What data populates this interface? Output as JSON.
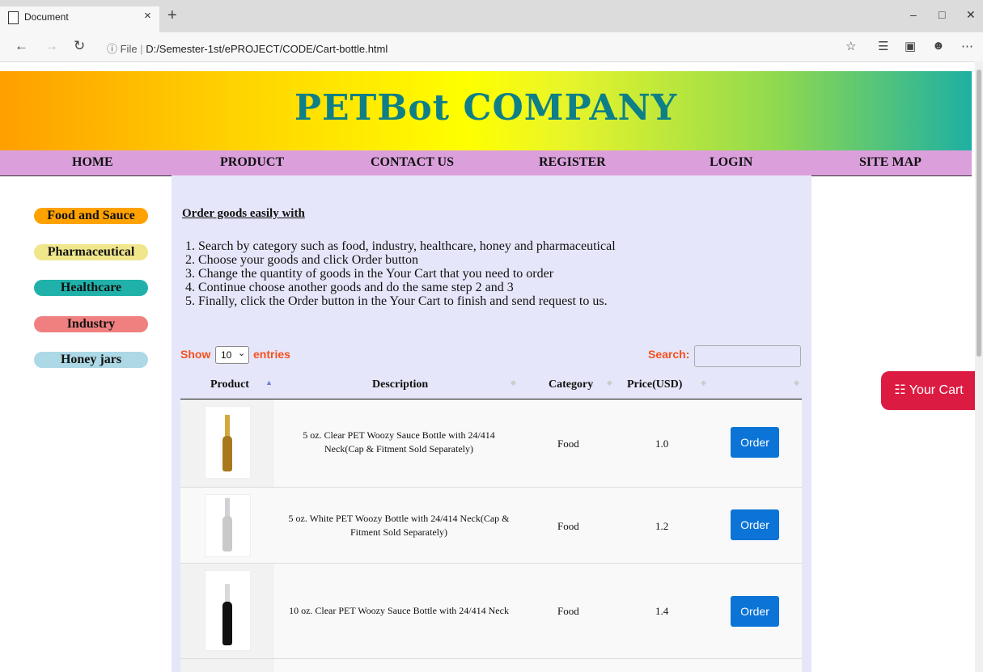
{
  "browser": {
    "tab_title": "Document",
    "tab_close": "×",
    "new_tab": "+",
    "address_prefix": "ⓘ File",
    "address_url": "D:/Semester-1st/ePROJECT/CODE/Cart-bottle.html"
  },
  "banner": {
    "title": "PETBot COMPANY"
  },
  "menu": [
    "HOME",
    "PRODUCT",
    "CONTACT US",
    "REGISTER",
    "LOGIN",
    "SITE MAP"
  ],
  "categories": [
    {
      "label": "Food and Sauce",
      "color": "#ffa200"
    },
    {
      "label": "Pharmaceutical",
      "color": "#f0e68c"
    },
    {
      "label": "Healthcare",
      "color": "#20b2aa"
    },
    {
      "label": "Industry",
      "color": "#f08080"
    },
    {
      "label": "Honey jars",
      "color": "#add8e6"
    }
  ],
  "intro": "Order goods easily with",
  "steps": [
    "1. Search by category such as food, industry, healthcare, honey and pharmaceutical",
    "2. Choose your goods and click Order button",
    "3. Change the quantity of goods in the Your Cart that you need to order",
    "4. Continue choose another goods and do the same step 2 and 3",
    "5. Finally, click the Order button in the Your Cart to finish and send request to us."
  ],
  "table": {
    "show_label": "Show",
    "entries_value": "10",
    "entries_label": "entries",
    "search_label": "Search:",
    "columns": [
      "Product",
      "Description",
      "Category",
      "Price(USD)"
    ],
    "order_label": "Order",
    "rows": [
      {
        "desc_line1": "5 oz. Clear PET Woozy Sauce Bottle with 24/414",
        "desc_line2": "Neck(Cap & Fitment Sold Separately)",
        "category": "Food",
        "price": "1.0",
        "bottle_color": "#a8791c"
      },
      {
        "desc_line1": "5 oz. White PET Woozy Bottle with 24/414 Neck(Cap &",
        "desc_line2": "Fitment Sold Separately)",
        "category": "Food",
        "price": "1.2",
        "bottle_color": "#c9c9cc"
      },
      {
        "desc_line1": "10 oz. Clear PET Woozy Sauce Bottle with 24/414 Neck",
        "desc_line2": "",
        "category": "Food",
        "price": "1.4",
        "bottle_color": "#111111"
      }
    ]
  },
  "cart": {
    "label": "Your Cart"
  }
}
